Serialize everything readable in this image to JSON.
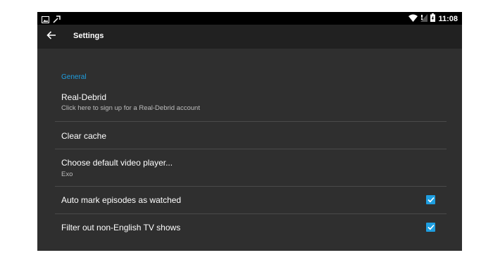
{
  "status_bar": {
    "left_icons": [
      "image-icon",
      "tool-icon"
    ],
    "right_icons": [
      "wifi-icon",
      "signal-icon",
      "battery-icon"
    ],
    "time": "11:08"
  },
  "app_bar": {
    "back_icon": "arrow-left-icon",
    "title": "Settings"
  },
  "settings": {
    "section_header": "General",
    "accent_color": "#1e9ee0",
    "items": [
      {
        "title": "Real-Debrid",
        "summary": "Click here to sign up for a Real-Debrid account"
      },
      {
        "title": "Clear cache"
      },
      {
        "title": "Choose default video player...",
        "summary": "Exo"
      },
      {
        "title": "Auto mark episodes as watched",
        "checked": true
      },
      {
        "title": "Filter out non-English TV shows",
        "checked": true
      }
    ]
  }
}
